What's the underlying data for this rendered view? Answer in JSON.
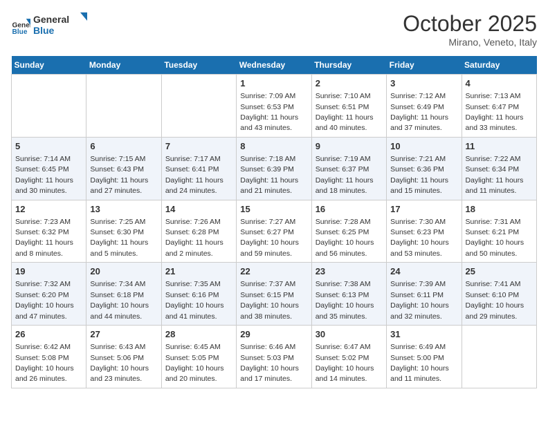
{
  "logo": {
    "line1": "General",
    "line2": "Blue"
  },
  "title": "October 2025",
  "subtitle": "Mirano, Veneto, Italy",
  "days_header": [
    "Sunday",
    "Monday",
    "Tuesday",
    "Wednesday",
    "Thursday",
    "Friday",
    "Saturday"
  ],
  "weeks": [
    [
      {
        "day": "",
        "info": ""
      },
      {
        "day": "",
        "info": ""
      },
      {
        "day": "",
        "info": ""
      },
      {
        "day": "1",
        "info": "Sunrise: 7:09 AM\nSunset: 6:53 PM\nDaylight: 11 hours and 43 minutes."
      },
      {
        "day": "2",
        "info": "Sunrise: 7:10 AM\nSunset: 6:51 PM\nDaylight: 11 hours and 40 minutes."
      },
      {
        "day": "3",
        "info": "Sunrise: 7:12 AM\nSunset: 6:49 PM\nDaylight: 11 hours and 37 minutes."
      },
      {
        "day": "4",
        "info": "Sunrise: 7:13 AM\nSunset: 6:47 PM\nDaylight: 11 hours and 33 minutes."
      }
    ],
    [
      {
        "day": "5",
        "info": "Sunrise: 7:14 AM\nSunset: 6:45 PM\nDaylight: 11 hours and 30 minutes."
      },
      {
        "day": "6",
        "info": "Sunrise: 7:15 AM\nSunset: 6:43 PM\nDaylight: 11 hours and 27 minutes."
      },
      {
        "day": "7",
        "info": "Sunrise: 7:17 AM\nSunset: 6:41 PM\nDaylight: 11 hours and 24 minutes."
      },
      {
        "day": "8",
        "info": "Sunrise: 7:18 AM\nSunset: 6:39 PM\nDaylight: 11 hours and 21 minutes."
      },
      {
        "day": "9",
        "info": "Sunrise: 7:19 AM\nSunset: 6:37 PM\nDaylight: 11 hours and 18 minutes."
      },
      {
        "day": "10",
        "info": "Sunrise: 7:21 AM\nSunset: 6:36 PM\nDaylight: 11 hours and 15 minutes."
      },
      {
        "day": "11",
        "info": "Sunrise: 7:22 AM\nSunset: 6:34 PM\nDaylight: 11 hours and 11 minutes."
      }
    ],
    [
      {
        "day": "12",
        "info": "Sunrise: 7:23 AM\nSunset: 6:32 PM\nDaylight: 11 hours and 8 minutes."
      },
      {
        "day": "13",
        "info": "Sunrise: 7:25 AM\nSunset: 6:30 PM\nDaylight: 11 hours and 5 minutes."
      },
      {
        "day": "14",
        "info": "Sunrise: 7:26 AM\nSunset: 6:28 PM\nDaylight: 11 hours and 2 minutes."
      },
      {
        "day": "15",
        "info": "Sunrise: 7:27 AM\nSunset: 6:27 PM\nDaylight: 10 hours and 59 minutes."
      },
      {
        "day": "16",
        "info": "Sunrise: 7:28 AM\nSunset: 6:25 PM\nDaylight: 10 hours and 56 minutes."
      },
      {
        "day": "17",
        "info": "Sunrise: 7:30 AM\nSunset: 6:23 PM\nDaylight: 10 hours and 53 minutes."
      },
      {
        "day": "18",
        "info": "Sunrise: 7:31 AM\nSunset: 6:21 PM\nDaylight: 10 hours and 50 minutes."
      }
    ],
    [
      {
        "day": "19",
        "info": "Sunrise: 7:32 AM\nSunset: 6:20 PM\nDaylight: 10 hours and 47 minutes."
      },
      {
        "day": "20",
        "info": "Sunrise: 7:34 AM\nSunset: 6:18 PM\nDaylight: 10 hours and 44 minutes."
      },
      {
        "day": "21",
        "info": "Sunrise: 7:35 AM\nSunset: 6:16 PM\nDaylight: 10 hours and 41 minutes."
      },
      {
        "day": "22",
        "info": "Sunrise: 7:37 AM\nSunset: 6:15 PM\nDaylight: 10 hours and 38 minutes."
      },
      {
        "day": "23",
        "info": "Sunrise: 7:38 AM\nSunset: 6:13 PM\nDaylight: 10 hours and 35 minutes."
      },
      {
        "day": "24",
        "info": "Sunrise: 7:39 AM\nSunset: 6:11 PM\nDaylight: 10 hours and 32 minutes."
      },
      {
        "day": "25",
        "info": "Sunrise: 7:41 AM\nSunset: 6:10 PM\nDaylight: 10 hours and 29 minutes."
      }
    ],
    [
      {
        "day": "26",
        "info": "Sunrise: 6:42 AM\nSunset: 5:08 PM\nDaylight: 10 hours and 26 minutes."
      },
      {
        "day": "27",
        "info": "Sunrise: 6:43 AM\nSunset: 5:06 PM\nDaylight: 10 hours and 23 minutes."
      },
      {
        "day": "28",
        "info": "Sunrise: 6:45 AM\nSunset: 5:05 PM\nDaylight: 10 hours and 20 minutes."
      },
      {
        "day": "29",
        "info": "Sunrise: 6:46 AM\nSunset: 5:03 PM\nDaylight: 10 hours and 17 minutes."
      },
      {
        "day": "30",
        "info": "Sunrise: 6:47 AM\nSunset: 5:02 PM\nDaylight: 10 hours and 14 minutes."
      },
      {
        "day": "31",
        "info": "Sunrise: 6:49 AM\nSunset: 5:00 PM\nDaylight: 10 hours and 11 minutes."
      },
      {
        "day": "",
        "info": ""
      }
    ]
  ]
}
